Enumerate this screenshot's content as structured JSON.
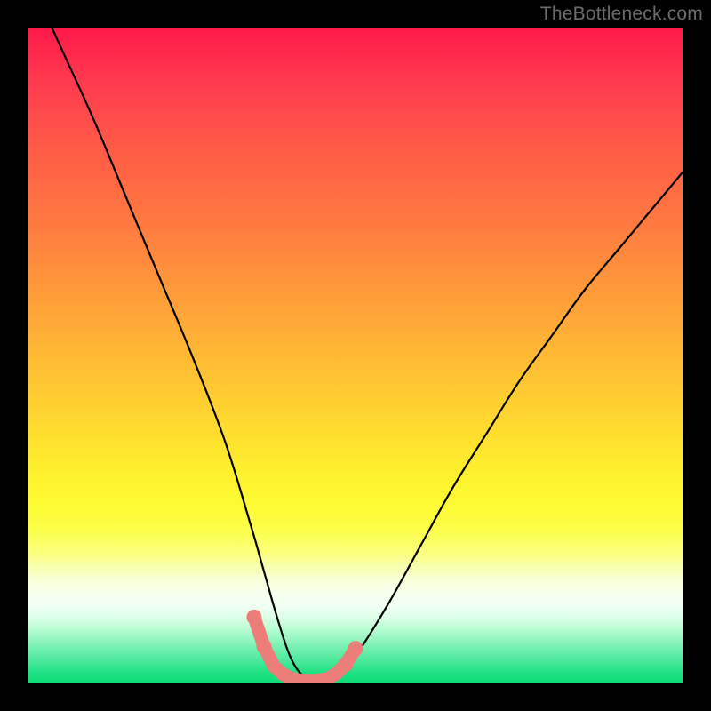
{
  "watermark": {
    "text": "TheBottleneck.com"
  },
  "chart_data": {
    "type": "line",
    "title": "",
    "xlabel": "",
    "ylabel": "",
    "xlim": [
      0,
      100
    ],
    "ylim": [
      0,
      100
    ],
    "grid": false,
    "series": [
      {
        "name": "bottleneck-curve",
        "x": [
          0,
          5,
          10,
          15,
          20,
          25,
          30,
          34,
          36,
          38,
          40,
          42,
          44,
          46,
          48,
          50,
          55,
          60,
          65,
          70,
          75,
          80,
          85,
          90,
          95,
          100
        ],
        "y": [
          108,
          97,
          86,
          74,
          62,
          50,
          37,
          24,
          17,
          10,
          4,
          1,
          0.5,
          0.5,
          1.5,
          4,
          12,
          21,
          30,
          38,
          46,
          53,
          60,
          66,
          72,
          78
        ]
      }
    ],
    "optimum_marker": {
      "x": [
        34.5,
        36.0,
        37.5,
        39.0,
        40.5,
        42.0,
        43.5,
        45.5,
        47.0,
        48.5,
        50.0
      ],
      "y": [
        10,
        5.5,
        2.5,
        1.2,
        0.5,
        0.3,
        0.3,
        0.5,
        1.3,
        2.8,
        5.2
      ],
      "color": "#ed7d79"
    }
  }
}
